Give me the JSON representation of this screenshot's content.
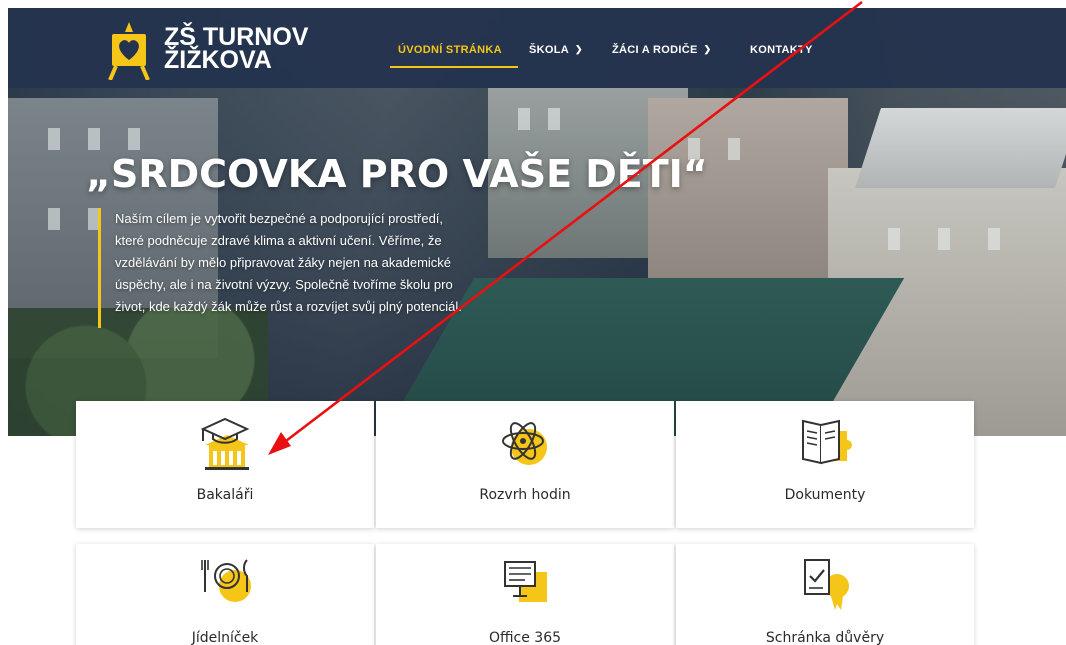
{
  "brand": {
    "logo_line1": "ZŠ TURNOV",
    "logo_line2": "ŽIŽKOVA",
    "accent_color": "#f5c518",
    "nav_bg_color": "#24334e"
  },
  "nav": {
    "items": [
      {
        "label": "ÚVODNÍ STRÁNKA",
        "active": true,
        "has_dropdown": false
      },
      {
        "label": "ŠKOLA",
        "active": false,
        "has_dropdown": true
      },
      {
        "label": "ŽÁCI A RODIČE",
        "active": false,
        "has_dropdown": true
      },
      {
        "label": "KONTAKTY",
        "active": false,
        "has_dropdown": false
      }
    ],
    "dropdown_icon": "chevron-down-icon"
  },
  "hero": {
    "title": "„SRDCOVKA PRO VAŠE DĚTI“",
    "quote_lines": [
      "Naším cílem je vytvořit bezpečné a podporující prostředí,",
      "které podněcuje zdravé klima a aktivní učení. Věříme, že",
      "vzdělávání by mělo připravovat žáky nejen na akademické",
      "úspěchy, ale i na životní výzvy. Společně tvoříme školu pro",
      "život, kde každý žák může růst a rozvíjet svůj plný potenciál."
    ]
  },
  "cards": [
    {
      "label": "Bakaláři",
      "icon": "school-building-graduation-cap-icon"
    },
    {
      "label": "Rozvrh hodin",
      "icon": "atom-icon"
    },
    {
      "label": "Dokumenty",
      "icon": "open-book-puzzle-icon"
    },
    {
      "label": "Jídelníček",
      "icon": "plate-cutlery-apple-icon"
    },
    {
      "label": "Office 365",
      "icon": "presentation-board-icon"
    },
    {
      "label": "Schránka důvěry",
      "icon": "checklist-badge-icon"
    }
  ],
  "annotation": {
    "arrow_color": "#e81010",
    "arrow_icon": "red-arrow-annotation"
  }
}
